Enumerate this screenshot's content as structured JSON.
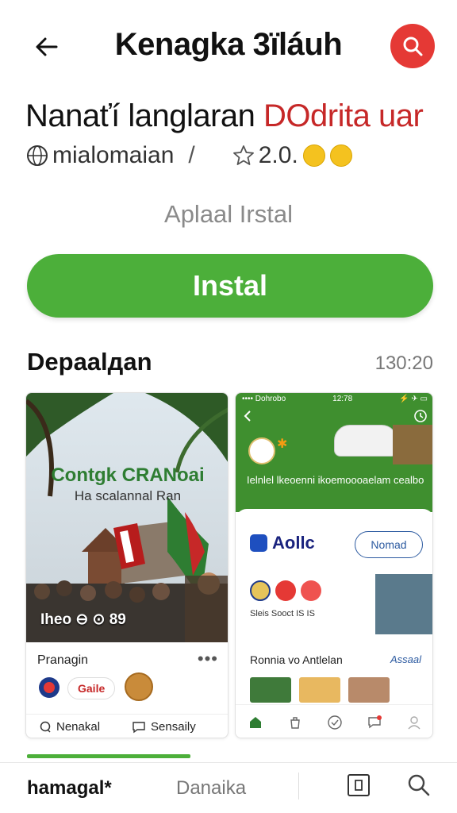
{
  "header": {
    "title": "Kenagka 3ïláuh",
    "back_icon": "arrow-left-icon",
    "search_icon": "search-icon",
    "accent_color": "#e53935"
  },
  "app": {
    "name_main": "Nanaťí langlaran ",
    "name_accent": "DOdrita uar",
    "developer": "mialomaian",
    "separator": "/",
    "rating": "2.0.",
    "subtitle": "Aplaal Irstal",
    "install_label": "Instal",
    "install_color": "#4caf3a"
  },
  "section": {
    "title": "Depaalдan",
    "time": "130:20"
  },
  "card1": {
    "photo_title": "Contgk CRANoai",
    "photo_subtitle": "Ha scalannal Ran",
    "photo_caption": "Iheo ⊖ ⊙ 89",
    "label": "Pranagin",
    "more": "•••",
    "chip": "Gaile",
    "action_left": "Nenakal",
    "action_right": "Sensaily"
  },
  "card2": {
    "status_left": "•••• Dohrobo",
    "status_time": "12:78",
    "status_right": "⚡ ✈ ▭",
    "promo_text": "Ielnlel lkeoenni ikoemoooaelam cealbollaei",
    "brand": "Aollc",
    "button": "Nomad",
    "meta": "Sleis  Sooct  IS IS",
    "section_label": "Ronnia vo Antlelan",
    "section_link": "Assaal"
  },
  "bottom_nav": {
    "home": "hamagal*",
    "categories": "Danaika"
  }
}
